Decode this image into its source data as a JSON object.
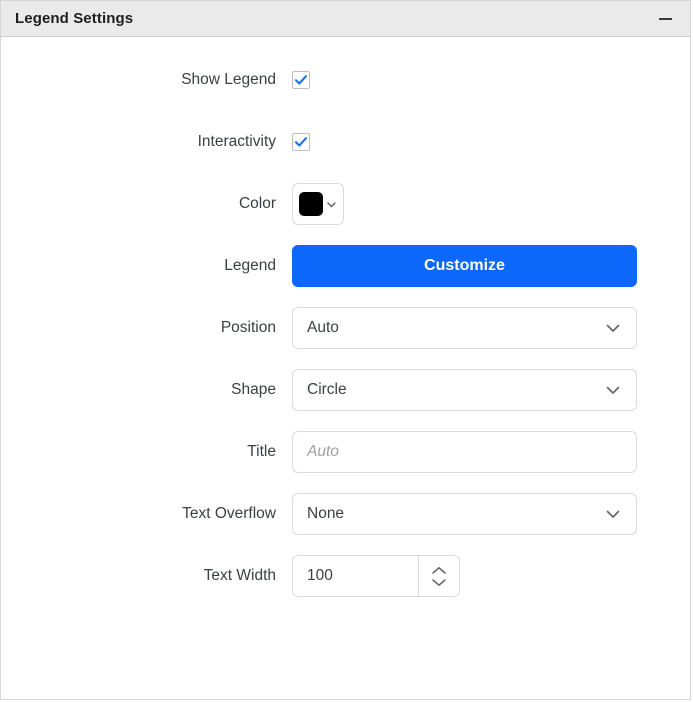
{
  "panel": {
    "title": "Legend Settings",
    "collapse_icon": "minus-icon",
    "accent_color": "#0b68fb",
    "header_background": "#eaeaea"
  },
  "rows": {
    "show_legend": {
      "label": "Show Legend",
      "checked": true,
      "icon": "checkmark-icon"
    },
    "interactivity": {
      "label": "Interactivity",
      "checked": true,
      "icon": "checkmark-icon"
    },
    "color": {
      "label": "Color",
      "value": "#000000",
      "icon": "chevron-down-icon"
    },
    "legend": {
      "label": "Legend",
      "button_label": "Customize"
    },
    "position": {
      "label": "Position",
      "value": "Auto",
      "icon": "chevron-down-icon"
    },
    "shape": {
      "label": "Shape",
      "value": "Circle",
      "icon": "chevron-down-icon"
    },
    "title": {
      "label": "Title",
      "value": "",
      "placeholder": "Auto"
    },
    "text_overflow": {
      "label": "Text Overflow",
      "value": "None",
      "icon": "chevron-down-icon"
    },
    "text_width": {
      "label": "Text Width",
      "value": "100",
      "increment_icon": "chevron-up-icon",
      "decrement_icon": "chevron-down-icon"
    }
  }
}
